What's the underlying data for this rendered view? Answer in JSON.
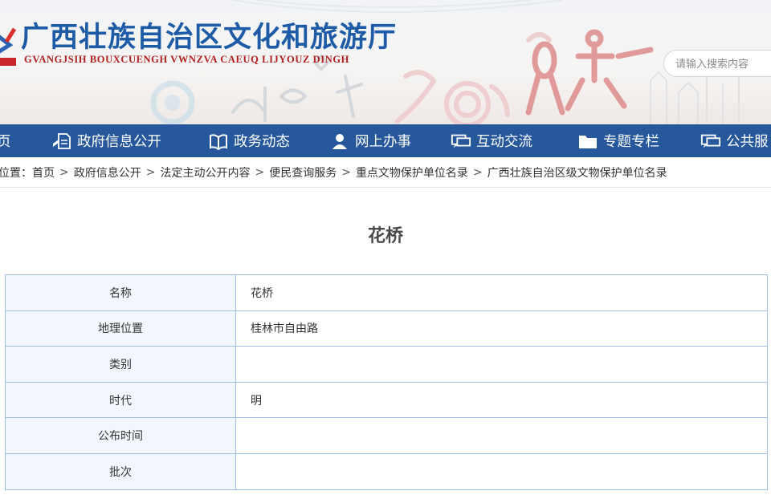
{
  "header": {
    "site_title": "广西壮族自治区文化和旅游厅",
    "site_subtitle": "GVANGJSIH BOUXCUENGH VWNZVA CAEUQ LIJYOUZ DINGH",
    "search_placeholder": "请输入搜索内容",
    "colors": {
      "title": "#1d5ba6",
      "subtitle": "#b01f1f",
      "nav": "#26589b"
    }
  },
  "nav": {
    "items": [
      {
        "label": "页",
        "icon": ""
      },
      {
        "label": "政府信息公开",
        "icon": "document-icon"
      },
      {
        "label": "政务动态",
        "icon": "book-icon"
      },
      {
        "label": "网上办事",
        "icon": "user-icon"
      },
      {
        "label": "互动交流",
        "icon": "chat-icon"
      },
      {
        "label": "专题专栏",
        "icon": "folder-icon"
      },
      {
        "label": "公共服",
        "icon": "chat-icon"
      }
    ]
  },
  "breadcrumb": {
    "prefix": "位置：",
    "items": [
      "首页",
      "政府信息公开",
      "法定主动公开内容",
      "便民查询服务",
      "重点文物保护单位名录",
      "广西壮族自治区级文物保护单位名录"
    ],
    "separator": ">"
  },
  "article": {
    "title": "花桥",
    "rows": [
      {
        "label": "名称",
        "value": "花桥"
      },
      {
        "label": "地理位置",
        "value": "桂林市自由路"
      },
      {
        "label": "类别",
        "value": ""
      },
      {
        "label": "时代",
        "value": "明"
      },
      {
        "label": "公布时间",
        "value": ""
      },
      {
        "label": "批次",
        "value": ""
      }
    ]
  }
}
